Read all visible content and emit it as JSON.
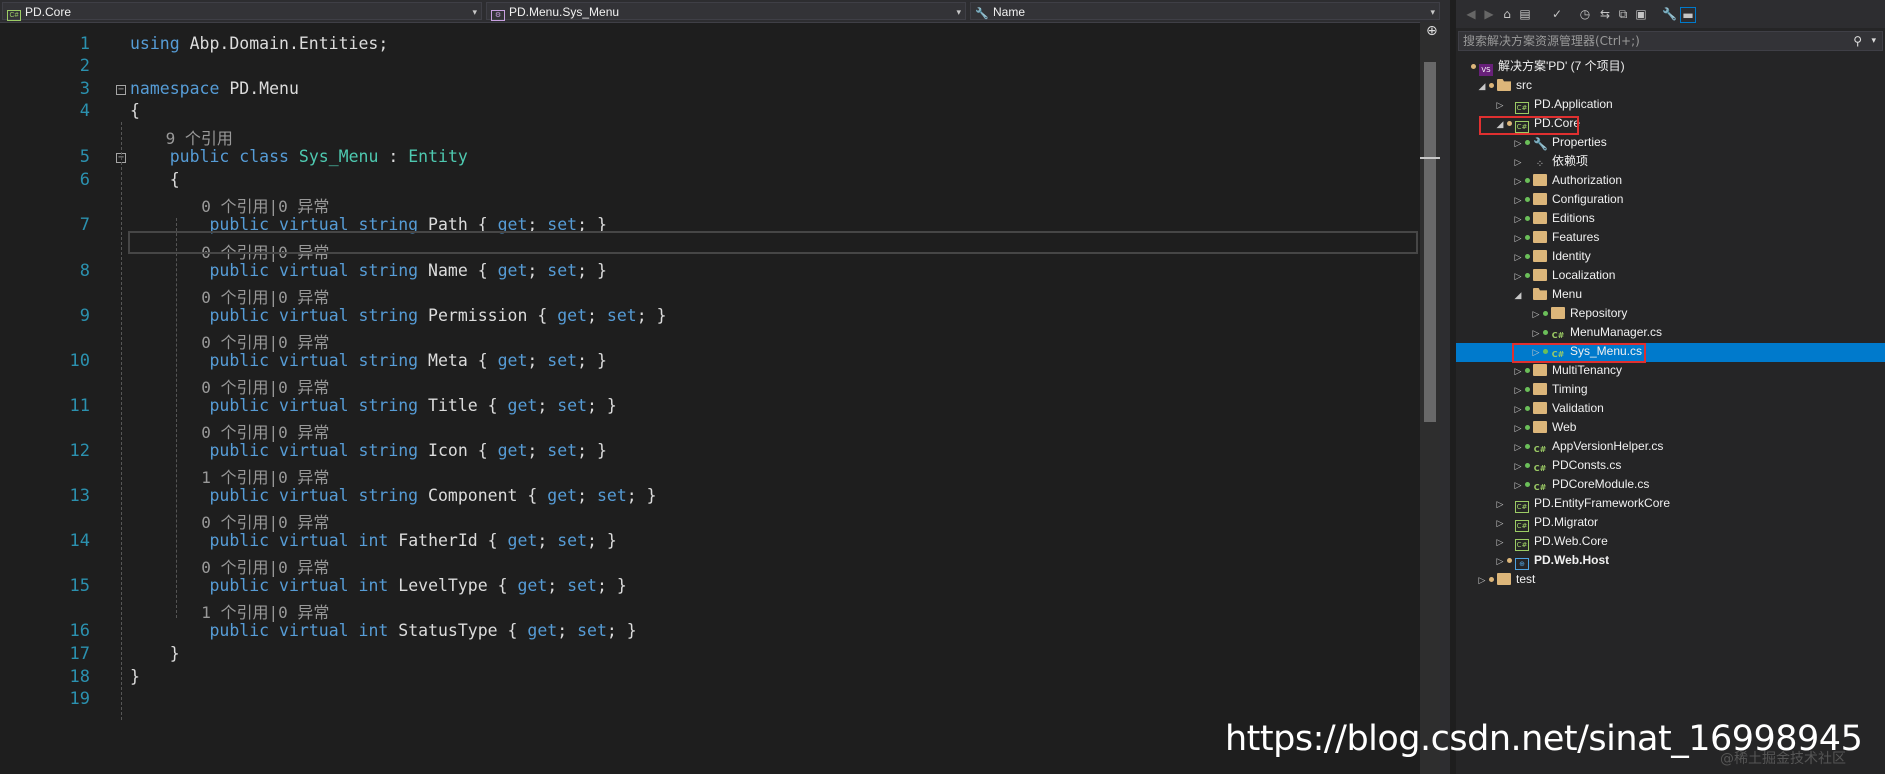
{
  "nav": {
    "project": "PD.Core",
    "class": "PD.Menu.Sys_Menu",
    "member": "Name"
  },
  "code": {
    "lines": [
      {
        "n": "1",
        "tokens": [
          [
            "kw",
            "using"
          ],
          [
            "tx",
            " Abp.Domain.Entities;"
          ]
        ]
      },
      {
        "n": "2",
        "tokens": []
      },
      {
        "n": "3",
        "tokens": [
          [
            "kw",
            "namespace"
          ],
          [
            "tx",
            " PD.Menu"
          ]
        ]
      },
      {
        "n": "4",
        "tokens": [
          [
            "tx",
            "{"
          ]
        ]
      },
      {
        "n": "5",
        "tokens": [
          [
            "tx",
            "    "
          ],
          [
            "kw",
            "public"
          ],
          [
            "tx",
            " "
          ],
          [
            "kw",
            "class"
          ],
          [
            "tx",
            " "
          ],
          [
            "ty",
            "Sys_Menu"
          ],
          [
            "tx",
            " : "
          ],
          [
            "ty",
            "Entity"
          ]
        ]
      },
      {
        "n": "6",
        "tokens": [
          [
            "tx",
            "    {"
          ]
        ]
      },
      {
        "n": "7",
        "tokens": [
          [
            "tx",
            "        "
          ],
          [
            "kw",
            "public"
          ],
          [
            "tx",
            " "
          ],
          [
            "kw",
            "virtual"
          ],
          [
            "tx",
            " "
          ],
          [
            "kw",
            "string"
          ],
          [
            "tx",
            " Path { "
          ],
          [
            "kw",
            "get"
          ],
          [
            "tx",
            "; "
          ],
          [
            "kw",
            "set"
          ],
          [
            "tx",
            "; }"
          ]
        ]
      },
      {
        "n": "8",
        "tokens": [
          [
            "tx",
            "        "
          ],
          [
            "kw",
            "public"
          ],
          [
            "tx",
            " "
          ],
          [
            "kw",
            "virtual"
          ],
          [
            "tx",
            " "
          ],
          [
            "kw",
            "string"
          ],
          [
            "tx",
            " Name { "
          ],
          [
            "kw",
            "get"
          ],
          [
            "tx",
            "; "
          ],
          [
            "kw",
            "set"
          ],
          [
            "tx",
            "; }"
          ]
        ]
      },
      {
        "n": "9",
        "tokens": [
          [
            "tx",
            "        "
          ],
          [
            "kw",
            "public"
          ],
          [
            "tx",
            " "
          ],
          [
            "kw",
            "virtual"
          ],
          [
            "tx",
            " "
          ],
          [
            "kw",
            "string"
          ],
          [
            "tx",
            " Permission { "
          ],
          [
            "kw",
            "get"
          ],
          [
            "tx",
            "; "
          ],
          [
            "kw",
            "set"
          ],
          [
            "tx",
            "; }"
          ]
        ]
      },
      {
        "n": "10",
        "tokens": [
          [
            "tx",
            "        "
          ],
          [
            "kw",
            "public"
          ],
          [
            "tx",
            " "
          ],
          [
            "kw",
            "virtual"
          ],
          [
            "tx",
            " "
          ],
          [
            "kw",
            "string"
          ],
          [
            "tx",
            " Meta { "
          ],
          [
            "kw",
            "get"
          ],
          [
            "tx",
            "; "
          ],
          [
            "kw",
            "set"
          ],
          [
            "tx",
            "; }"
          ]
        ]
      },
      {
        "n": "11",
        "tokens": [
          [
            "tx",
            "        "
          ],
          [
            "kw",
            "public"
          ],
          [
            "tx",
            " "
          ],
          [
            "kw",
            "virtual"
          ],
          [
            "tx",
            " "
          ],
          [
            "kw",
            "string"
          ],
          [
            "tx",
            " Title { "
          ],
          [
            "kw",
            "get"
          ],
          [
            "tx",
            "; "
          ],
          [
            "kw",
            "set"
          ],
          [
            "tx",
            "; }"
          ]
        ]
      },
      {
        "n": "12",
        "tokens": [
          [
            "tx",
            "        "
          ],
          [
            "kw",
            "public"
          ],
          [
            "tx",
            " "
          ],
          [
            "kw",
            "virtual"
          ],
          [
            "tx",
            " "
          ],
          [
            "kw",
            "string"
          ],
          [
            "tx",
            " Icon { "
          ],
          [
            "kw",
            "get"
          ],
          [
            "tx",
            "; "
          ],
          [
            "kw",
            "set"
          ],
          [
            "tx",
            "; }"
          ]
        ]
      },
      {
        "n": "13",
        "tokens": [
          [
            "tx",
            "        "
          ],
          [
            "kw",
            "public"
          ],
          [
            "tx",
            " "
          ],
          [
            "kw",
            "virtual"
          ],
          [
            "tx",
            " "
          ],
          [
            "kw",
            "string"
          ],
          [
            "tx",
            " Component { "
          ],
          [
            "kw",
            "get"
          ],
          [
            "tx",
            "; "
          ],
          [
            "kw",
            "set"
          ],
          [
            "tx",
            "; }"
          ]
        ]
      },
      {
        "n": "14",
        "tokens": [
          [
            "tx",
            "        "
          ],
          [
            "kw",
            "public"
          ],
          [
            "tx",
            " "
          ],
          [
            "kw",
            "virtual"
          ],
          [
            "tx",
            " "
          ],
          [
            "kw",
            "int"
          ],
          [
            "tx",
            " FatherId { "
          ],
          [
            "kw",
            "get"
          ],
          [
            "tx",
            "; "
          ],
          [
            "kw",
            "set"
          ],
          [
            "tx",
            "; }"
          ]
        ]
      },
      {
        "n": "15",
        "tokens": [
          [
            "tx",
            "        "
          ],
          [
            "kw",
            "public"
          ],
          [
            "tx",
            " "
          ],
          [
            "kw",
            "virtual"
          ],
          [
            "tx",
            " "
          ],
          [
            "kw",
            "int"
          ],
          [
            "tx",
            " LevelType { "
          ],
          [
            "kw",
            "get"
          ],
          [
            "tx",
            "; "
          ],
          [
            "kw",
            "set"
          ],
          [
            "tx",
            "; }"
          ]
        ]
      },
      {
        "n": "16",
        "tokens": [
          [
            "tx",
            "        "
          ],
          [
            "kw",
            "public"
          ],
          [
            "tx",
            " "
          ],
          [
            "kw",
            "virtual"
          ],
          [
            "tx",
            " "
          ],
          [
            "kw",
            "int"
          ],
          [
            "tx",
            " StatusType { "
          ],
          [
            "kw",
            "get"
          ],
          [
            "tx",
            "; "
          ],
          [
            "kw",
            "set"
          ],
          [
            "tx",
            "; }"
          ]
        ]
      },
      {
        "n": "17",
        "tokens": [
          [
            "tx",
            "    }"
          ]
        ]
      },
      {
        "n": "18",
        "tokens": [
          [
            "tx",
            "}"
          ]
        ]
      },
      {
        "n": "19",
        "tokens": []
      }
    ],
    "lens": [
      {
        "before": "5",
        "text": "9 个引用",
        "indent": 1
      },
      {
        "before": "7",
        "text": "0 个引用|0 异常",
        "indent": 2
      },
      {
        "before": "8",
        "text": "0 个引用|0 异常",
        "indent": 2
      },
      {
        "before": "9",
        "text": "0 个引用|0 异常",
        "indent": 2
      },
      {
        "before": "10",
        "text": "0 个引用|0 异常",
        "indent": 2
      },
      {
        "before": "11",
        "text": "0 个引用|0 异常",
        "indent": 2
      },
      {
        "before": "12",
        "text": "0 个引用|0 异常",
        "indent": 2
      },
      {
        "before": "13",
        "text": "1 个引用|0 异常",
        "indent": 2
      },
      {
        "before": "14",
        "text": "0 个引用|0 异常",
        "indent": 2
      },
      {
        "before": "15",
        "text": "0 个引用|0 异常",
        "indent": 2
      },
      {
        "before": "16",
        "text": "1 个引用|0 异常",
        "indent": 2
      }
    ]
  },
  "explorer": {
    "search_placeholder": "搜索解决方案资源管理器(Ctrl+;)",
    "items": [
      {
        "label": "解决方案'PD' (7 个项目)",
        "level": 0,
        "icon": "sln",
        "twisty": "",
        "dot": "#dcb67a",
        "bold": false
      },
      {
        "label": "src",
        "level": 1,
        "icon": "folderopen",
        "twisty": "◢",
        "dot": "#dcb67a",
        "bold": false
      },
      {
        "label": "PD.Application",
        "level": 2,
        "icon": "proj",
        "twisty": "▷",
        "dot": "",
        "bold": false
      },
      {
        "label": "PD.Core",
        "level": 2,
        "icon": "proj",
        "twisty": "◢",
        "dot": "#dcb67a",
        "bold": false
      },
      {
        "label": "Properties",
        "level": 3,
        "icon": "wrench",
        "twisty": "▷",
        "dot": "#6bbf59",
        "bold": false
      },
      {
        "label": "依赖项",
        "level": 3,
        "icon": "deps",
        "twisty": "▷",
        "dot": "",
        "bold": false
      },
      {
        "label": "Authorization",
        "level": 3,
        "icon": "folder",
        "twisty": "▷",
        "dot": "#6bbf59",
        "bold": false
      },
      {
        "label": "Configuration",
        "level": 3,
        "icon": "folder",
        "twisty": "▷",
        "dot": "#6bbf59",
        "bold": false
      },
      {
        "label": "Editions",
        "level": 3,
        "icon": "folder",
        "twisty": "▷",
        "dot": "#6bbf59",
        "bold": false
      },
      {
        "label": "Features",
        "level": 3,
        "icon": "folder",
        "twisty": "▷",
        "dot": "#6bbf59",
        "bold": false
      },
      {
        "label": "Identity",
        "level": 3,
        "icon": "folder",
        "twisty": "▷",
        "dot": "#6bbf59",
        "bold": false
      },
      {
        "label": "Localization",
        "level": 3,
        "icon": "folder",
        "twisty": "▷",
        "dot": "#6bbf59",
        "bold": false
      },
      {
        "label": "Menu",
        "level": 3,
        "icon": "folderopen",
        "twisty": "◢",
        "dot": "",
        "bold": false
      },
      {
        "label": "Repository",
        "level": 4,
        "icon": "folder",
        "twisty": "▷",
        "dot": "#6bbf59",
        "bold": false
      },
      {
        "label": "MenuManager.cs",
        "level": 4,
        "icon": "cs",
        "twisty": "▷",
        "dot": "#6bbf59",
        "bold": false
      },
      {
        "label": "Sys_Menu.cs",
        "level": 4,
        "icon": "cs",
        "twisty": "▷",
        "dot": "#6bbf59",
        "bold": false
      },
      {
        "label": "MultiTenancy",
        "level": 3,
        "icon": "folder",
        "twisty": "▷",
        "dot": "#6bbf59",
        "bold": false
      },
      {
        "label": "Timing",
        "level": 3,
        "icon": "folder",
        "twisty": "▷",
        "dot": "#6bbf59",
        "bold": false
      },
      {
        "label": "Validation",
        "level": 3,
        "icon": "folder",
        "twisty": "▷",
        "dot": "#6bbf59",
        "bold": false
      },
      {
        "label": "Web",
        "level": 3,
        "icon": "folder",
        "twisty": "▷",
        "dot": "#6bbf59",
        "bold": false
      },
      {
        "label": "AppVersionHelper.cs",
        "level": 3,
        "icon": "cs",
        "twisty": "▷",
        "dot": "#6bbf59",
        "bold": false
      },
      {
        "label": "PDConsts.cs",
        "level": 3,
        "icon": "cs",
        "twisty": "▷",
        "dot": "#6bbf59",
        "bold": false
      },
      {
        "label": "PDCoreModule.cs",
        "level": 3,
        "icon": "cs",
        "twisty": "▷",
        "dot": "#6bbf59",
        "bold": false
      },
      {
        "label": "PD.EntityFrameworkCore",
        "level": 2,
        "icon": "proj",
        "twisty": "▷",
        "dot": "",
        "bold": false
      },
      {
        "label": "PD.Migrator",
        "level": 2,
        "icon": "proj",
        "twisty": "▷",
        "dot": "",
        "bold": false
      },
      {
        "label": "PD.Web.Core",
        "level": 2,
        "icon": "proj",
        "twisty": "▷",
        "dot": "",
        "bold": false
      },
      {
        "label": "PD.Web.Host",
        "level": 2,
        "icon": "web",
        "twisty": "▷",
        "dot": "#dcb67a",
        "bold": true
      },
      {
        "label": "test",
        "level": 1,
        "icon": "folder",
        "twisty": "▷",
        "dot": "#dcb67a",
        "bold": false
      }
    ]
  },
  "watermark": "https://blog.csdn.net/sinat_16998945",
  "watermark_small": "@稀土掘金技术社区"
}
